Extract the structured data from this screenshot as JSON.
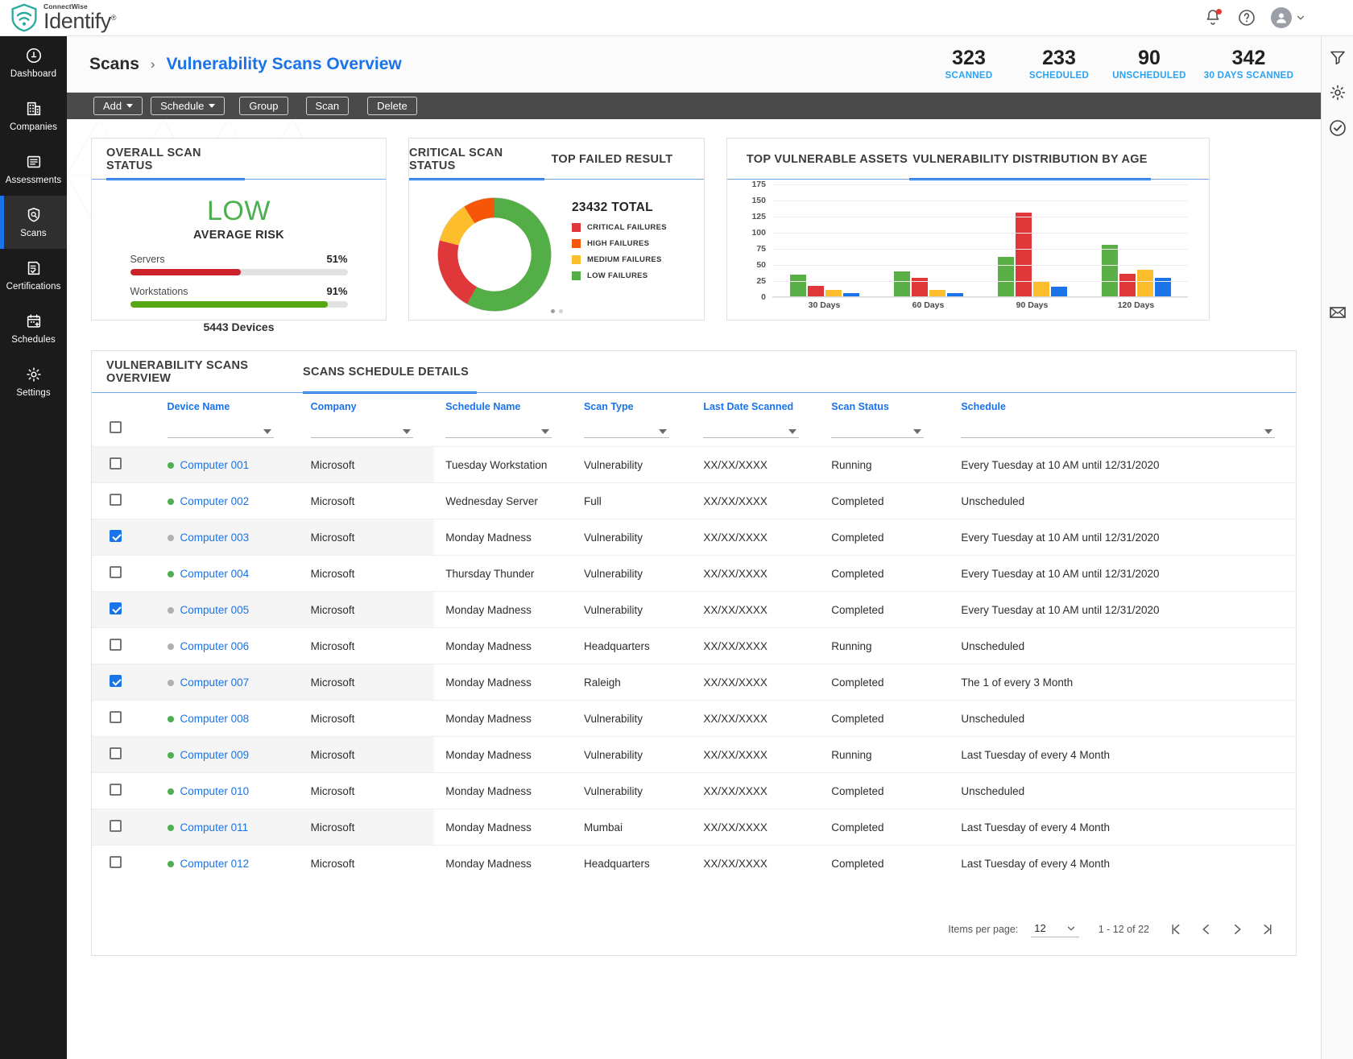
{
  "brand": {
    "sup": "ConnectWise",
    "name": "Identify",
    "reg": "®"
  },
  "topbar": {
    "notifications_icon": "bell-icon",
    "help_icon": "help-circle-icon",
    "account_icon": "user-avatar-icon",
    "account_caret": "chevron-down-icon"
  },
  "sidebar": {
    "items": [
      {
        "label": "Dashboard",
        "icon": "gauge-icon",
        "active": false
      },
      {
        "label": "Companies",
        "icon": "building-icon",
        "active": false
      },
      {
        "label": "Assessments",
        "icon": "list-doc-icon",
        "active": false
      },
      {
        "label": "Scans",
        "icon": "shield-search-icon",
        "active": true
      },
      {
        "label": "Certifications",
        "icon": "certificate-icon",
        "active": false
      },
      {
        "label": "Schedules",
        "icon": "calendar-add-icon",
        "active": false
      },
      {
        "label": "Settings",
        "icon": "gear-icon",
        "active": false
      }
    ]
  },
  "rightrail": {
    "items": [
      {
        "icon": "filter-icon"
      },
      {
        "icon": "settings-gear-icon"
      },
      {
        "icon": "check-circle-icon"
      },
      {
        "icon": "envelope-icon"
      }
    ]
  },
  "breadcrumb": {
    "root": "Scans",
    "separator": "›",
    "current": "Vulnerability Scans Overview"
  },
  "stats": [
    {
      "value": "323",
      "label": "SCANNED"
    },
    {
      "value": "233",
      "label": "SCHEDULED"
    },
    {
      "value": "90",
      "label": "UNSCHEDULED"
    },
    {
      "value": "342",
      "label": "30 DAYS SCANNED"
    }
  ],
  "actionbar": {
    "buttons": [
      {
        "label": "Add",
        "caret": true
      },
      {
        "label": "Schedule",
        "caret": true
      },
      {
        "label": "Group",
        "caret": false
      },
      {
        "label": "Scan",
        "caret": false
      },
      {
        "label": "Delete",
        "caret": false
      }
    ]
  },
  "scan_status_card": {
    "tab": "OVERALL SCAN STATUS",
    "risk_word": "LOW",
    "risk_sub": "AVERAGE RISK",
    "devices": "5443 Devices",
    "meters": [
      {
        "name": "Servers",
        "pct": "51%",
        "value": 51,
        "color": "#cc2229"
      },
      {
        "name": "Workstations",
        "pct": "91%",
        "value": 91,
        "color": "#57a614"
      }
    ]
  },
  "critical_card": {
    "tabs": [
      {
        "label": "CRITICAL SCAN STATUS",
        "active": true
      },
      {
        "label": "TOP FAILED RESULT",
        "active": false
      }
    ],
    "total": "23432 TOTAL",
    "legend": [
      {
        "label": "CRITICAL FAILURES",
        "color": "#e0383a"
      },
      {
        "label": "HIGH FAILURES",
        "color": "#f5560a"
      },
      {
        "label": "MEDIUM FAILURES",
        "color": "#fcbe2c"
      },
      {
        "label": "LOW FAILURES",
        "color": "#54ae47"
      }
    ]
  },
  "age_card": {
    "tabs": [
      {
        "label": "TOP VULNERABLE ASSETS",
        "active": false
      },
      {
        "label": "VULNERABILITY DISTRIBUTION BY AGE",
        "active": true
      }
    ]
  },
  "chart_data": [
    {
      "type": "pie",
      "title": "CRITICAL SCAN STATUS",
      "total": 23432,
      "labels": [
        "LOW FAILURES",
        "CRITICAL FAILURES",
        "MEDIUM FAILURES",
        "HIGH FAILURES"
      ],
      "values": [
        58,
        21,
        12,
        9
      ],
      "colors": [
        "#54ae47",
        "#e0383a",
        "#fcbe2c",
        "#f5560a"
      ],
      "legend_position": "right",
      "donut": true
    },
    {
      "type": "bar",
      "title": "VULNERABILITY DISTRIBUTION BY AGE",
      "categories": [
        "30 Days",
        "60 Days",
        "90 Days",
        "120 Days"
      ],
      "series": [
        {
          "name": "Low",
          "color": "#5aaf46",
          "values": [
            34,
            39,
            61,
            80
          ]
        },
        {
          "name": "Critical",
          "color": "#e0383a",
          "values": [
            16,
            29,
            130,
            35
          ]
        },
        {
          "name": "Medium",
          "color": "#fcbe2c",
          "values": [
            10,
            10,
            22,
            41
          ]
        },
        {
          "name": "High",
          "color": "#1a73e8",
          "values": [
            5,
            5,
            15,
            29
          ]
        }
      ],
      "yticks": [
        0,
        25,
        50,
        75,
        100,
        125,
        150,
        175
      ],
      "ylim": [
        0,
        175
      ],
      "xlabel": "",
      "ylabel": "",
      "grid": true,
      "legend_position": "none"
    }
  ],
  "table_panel": {
    "tabs": [
      {
        "label": "VULNERABILITY SCANS OVERVIEW",
        "active": false
      },
      {
        "label": "SCANS SCHEDULE DETAILS",
        "active": true
      }
    ],
    "columns": [
      "Device Name",
      "Company",
      "Schedule Name",
      "Scan Type",
      "Last Date Scanned",
      "Scan Status",
      "Schedule"
    ],
    "rows": [
      {
        "checked": false,
        "dot": "green",
        "device": "Computer 001",
        "company": "Microsoft",
        "schedule_name": "Tuesday Workstation",
        "scan_type": "Vulnerability",
        "last_date": "XX/XX/XXXX",
        "status": "Running",
        "schedule": "Every Tuesday at 10 AM until 12/31/2020"
      },
      {
        "checked": false,
        "dot": "green",
        "device": "Computer 002",
        "company": "Microsoft",
        "schedule_name": "Wednesday Server",
        "scan_type": "Full",
        "last_date": "XX/XX/XXXX",
        "status": "Completed",
        "schedule": "Unscheduled"
      },
      {
        "checked": true,
        "dot": "gray",
        "device": "Computer 003",
        "company": "Microsoft",
        "schedule_name": "Monday Madness",
        "scan_type": "Vulnerability",
        "last_date": "XX/XX/XXXX",
        "status": "Completed",
        "schedule": "Every Tuesday at 10 AM until 12/31/2020"
      },
      {
        "checked": false,
        "dot": "green",
        "device": "Computer 004",
        "company": "Microsoft",
        "schedule_name": "Thursday Thunder",
        "scan_type": "Vulnerability",
        "last_date": "XX/XX/XXXX",
        "status": "Completed",
        "schedule": "Every Tuesday at 10 AM until 12/31/2020"
      },
      {
        "checked": true,
        "dot": "gray",
        "device": "Computer 005",
        "company": "Microsoft",
        "schedule_name": "Monday Madness",
        "scan_type": "Vulnerability",
        "last_date": "XX/XX/XXXX",
        "status": "Completed",
        "schedule": "Every Tuesday at 10 AM until 12/31/2020"
      },
      {
        "checked": false,
        "dot": "gray",
        "device": "Computer 006",
        "company": "Microsoft",
        "schedule_name": "Monday Madness",
        "scan_type": "Headquarters",
        "last_date": "XX/XX/XXXX",
        "status": "Running",
        "schedule": "Unscheduled"
      },
      {
        "checked": true,
        "dot": "gray",
        "device": "Computer 007",
        "company": "Microsoft",
        "schedule_name": "Monday Madness",
        "scan_type": "Raleigh",
        "last_date": "XX/XX/XXXX",
        "status": "Completed",
        "schedule": "The 1 of every 3 Month"
      },
      {
        "checked": false,
        "dot": "green",
        "device": "Computer 008",
        "company": "Microsoft",
        "schedule_name": "Monday Madness",
        "scan_type": "Vulnerability",
        "last_date": "XX/XX/XXXX",
        "status": "Completed",
        "schedule": "Unscheduled"
      },
      {
        "checked": false,
        "dot": "green",
        "device": "Computer 009",
        "company": "Microsoft",
        "schedule_name": "Monday Madness",
        "scan_type": "Vulnerability",
        "last_date": "XX/XX/XXXX",
        "status": "Running",
        "schedule": "Last Tuesday of every 4 Month"
      },
      {
        "checked": false,
        "dot": "green",
        "device": "Computer 010",
        "company": "Microsoft",
        "schedule_name": "Monday Madness",
        "scan_type": "Vulnerability",
        "last_date": "XX/XX/XXXX",
        "status": "Completed",
        "schedule": "Unscheduled"
      },
      {
        "checked": false,
        "dot": "green",
        "device": "Computer 011",
        "company": "Microsoft",
        "schedule_name": "Monday Madness",
        "scan_type": "Mumbai",
        "last_date": "XX/XX/XXXX",
        "status": "Completed",
        "schedule": "Last Tuesday of every 4 Month"
      },
      {
        "checked": false,
        "dot": "green",
        "device": "Computer 012",
        "company": "Microsoft",
        "schedule_name": "Monday Madness",
        "scan_type": "Headquarters",
        "last_date": "XX/XX/XXXX",
        "status": "Completed",
        "schedule": "Last Tuesday of every 4 Month"
      }
    ],
    "paginator": {
      "items_per_page_label": "Items per page:",
      "items_per_page_value": "12",
      "range": "1 - 12 of 22",
      "first_icon": "first-page-icon",
      "prev_icon": "prev-page-icon",
      "next_icon": "next-page-icon",
      "last_icon": "last-page-icon"
    }
  }
}
